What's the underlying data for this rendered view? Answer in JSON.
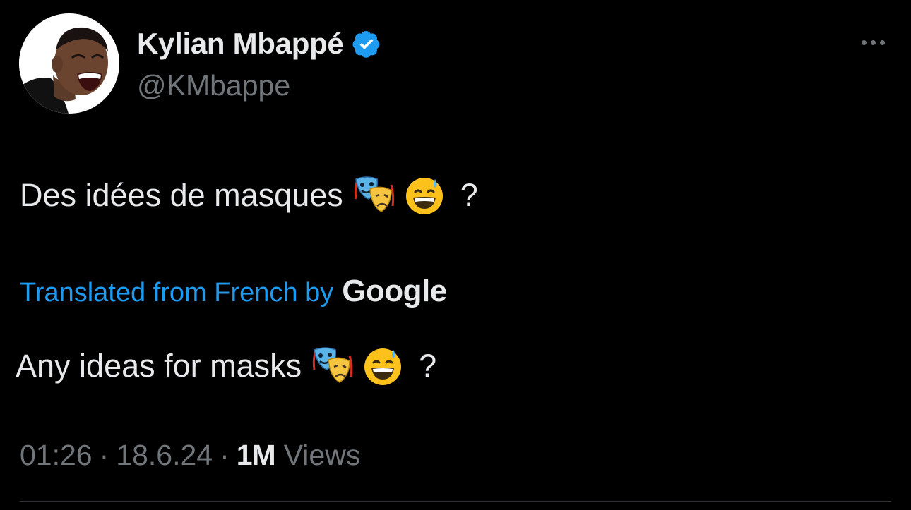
{
  "user": {
    "display_name": "Kylian Mbappé",
    "handle": "@KMbappe",
    "verified": true,
    "avatar_icon": "profile-photo"
  },
  "menu": {
    "more_icon": "more-horizontal-icon"
  },
  "tweet": {
    "text_before_emoji": "Des idées de masques",
    "emojis": [
      "performing-arts-emoji",
      "grinning-face-with-sweat-emoji"
    ],
    "text_after_emoji": "?"
  },
  "translation": {
    "link_text": "Translated from French by",
    "provider": "Google",
    "text_before_emoji": "Any ideas for masks",
    "text_after_emoji": "?"
  },
  "meta": {
    "time": "01:26",
    "separator": "·",
    "date": "18.6.24",
    "views_count": "1M",
    "views_label": "Views"
  },
  "colors": {
    "background": "#000000",
    "primary_text": "#e7e9ea",
    "secondary_text": "#71767b",
    "link": "#1d9bf0",
    "verified_badge": "#1d9bf0",
    "divider": "#2f3336"
  }
}
